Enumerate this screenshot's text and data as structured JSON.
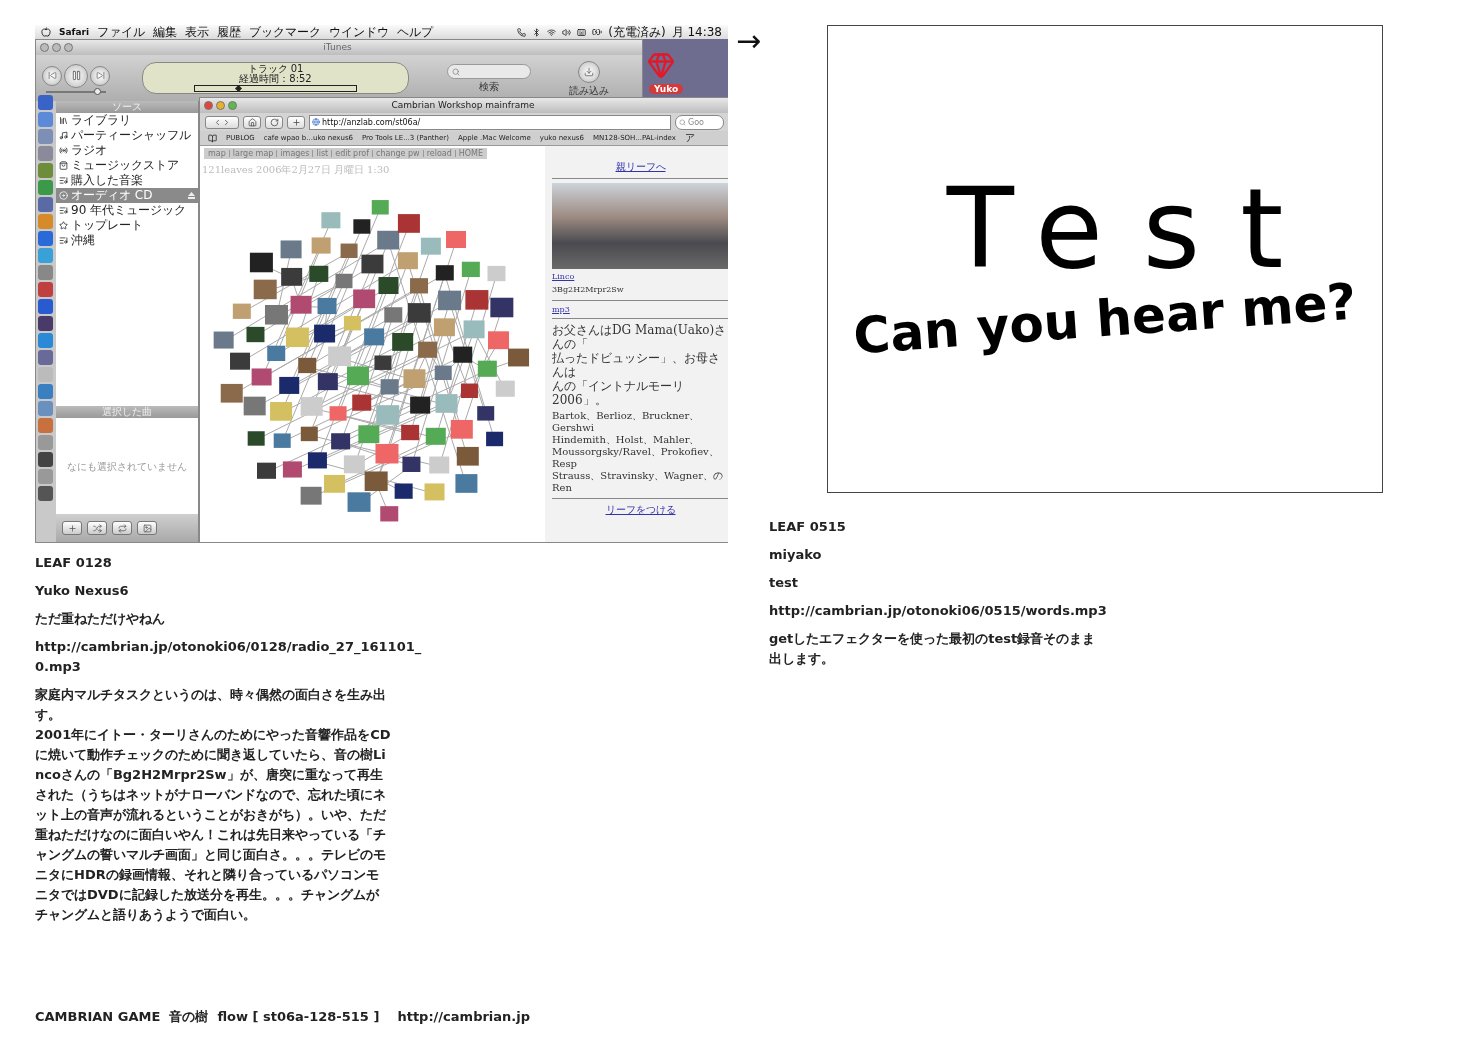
{
  "screenshot": {
    "menubar": {
      "app": "Safari",
      "menus": [
        "ファイル",
        "編集",
        "表示",
        "履歴",
        "ブックマーク",
        "ウインドウ",
        "ヘルプ"
      ],
      "battery": "(充電済み)",
      "clock": "月 14:38"
    },
    "itunes": {
      "title": "iTunes",
      "volume": {
        "level": 0.85
      },
      "display": {
        "track": "トラック 01",
        "elapsed": "経過時間：8:52",
        "level": 0.27
      },
      "search_label": "検索",
      "import_label": "読み込み",
      "sidebar": {
        "heading": "ソース",
        "items": [
          {
            "label": "ライブラリ",
            "selected": false
          },
          {
            "label": "パーティーシャッフル",
            "selected": false
          },
          {
            "label": "ラジオ",
            "selected": false
          },
          {
            "label": "ミュージックストア",
            "selected": false
          },
          {
            "label": "購入した音楽",
            "selected": false
          },
          {
            "label": "オーディオ CD",
            "selected": true
          },
          {
            "label": "90 年代ミュージック",
            "selected": false
          },
          {
            "label": "トップレート",
            "selected": false
          },
          {
            "label": "沖縄",
            "selected": false
          }
        ],
        "selection_heading": "選択した曲",
        "empty_text": "なにも選択されていません"
      }
    },
    "desktop_label": "Yuko",
    "safari": {
      "title": "Cambrian Workshop mainframe",
      "url": "http://anzlab.com/st06a/",
      "search": {
        "placeholder": "Goo"
      },
      "bookmarks": [
        "PUBLOG",
        "cafe wpao b...uko nexus6",
        "Pro Tools LE...3 (Panther)",
        "Apple .Mac Welcome",
        "yuko nexus6",
        "MN128-SOH...PAL-index",
        "ア"
      ],
      "nav_links": [
        "map",
        "large map",
        "images",
        "list",
        "edit prof",
        "change pw",
        "reload",
        "HOME"
      ],
      "caption": "121leaves 2006年2月27日 月曜日 1:30",
      "panel": {
        "parent_link": "親リーフへ",
        "author_link": "Linco",
        "leaf_name": "3Bg2H2Mrpr2Sw",
        "mp3_link": "mp3",
        "note_lines": [
          "お父さんはDG Mama(Uako)さんの「",
          "払ったドビュッシー」、お母さんは",
          "んの「イントナルモーリ 2006」。"
        ],
        "composer_lines": [
          "Bartok、Berlioz、Bruckner、Gershwi",
          "Hindemith、Holst、Mahler、",
          "Moussorgsky/Ravel、Prokofiev、Resp",
          "Strauss、Stravinsky、Wagner、のRen"
        ],
        "add_link": "リーフをつける"
      }
    }
  },
  "arrow": "→",
  "drawing": {
    "lines": [
      "Test",
      "Can you hear me?"
    ]
  },
  "leaves": [
    {
      "title": "LEAF 0128",
      "author": "Yuko Nexus6",
      "subtitle": "ただ重ねただけやねん",
      "url": "http://cambrian.jp/otonoki06/0128/radio_27_161101_0.mp3",
      "body": "家庭内マルチタスクというのは、時々偶然の面白さを生み出す。\n2001年にイトー・ターリさんのためにやった音響作品をCDに焼いて動作チェックのために聞き返していたら、音の樹Lincoさんの「Bg2H2Mrpr2Sw」が、唐突に重なって再生された（うちはネットがナローバンドなので、忘れた頃にネット上の音声が流れるということがおきがち）。いや、ただ重ねただけなのに面白いやん！これは先日来やっている「チャングムの誓いマルチ画面」と同じ面白さ。。。テレビのモニタにHDRの録画情報、それと隣り合っているパソコンモニタではDVDに記録した放送分を再生。。。チャングムがチャングムと語りあうようで面白い。"
    },
    {
      "title": "LEAF 0515",
      "author": "miyako",
      "subtitle": "test",
      "url": "http://cambrian.jp/otonoki06/0515/words.mp3",
      "body": "getしたエフェクターを使った最初のtest録音そのまま出します。"
    }
  ],
  "footer": "CAMBRIAN GAME  音の樹  flow [ st06a-128-515 ]    http://cambrian.jp"
}
